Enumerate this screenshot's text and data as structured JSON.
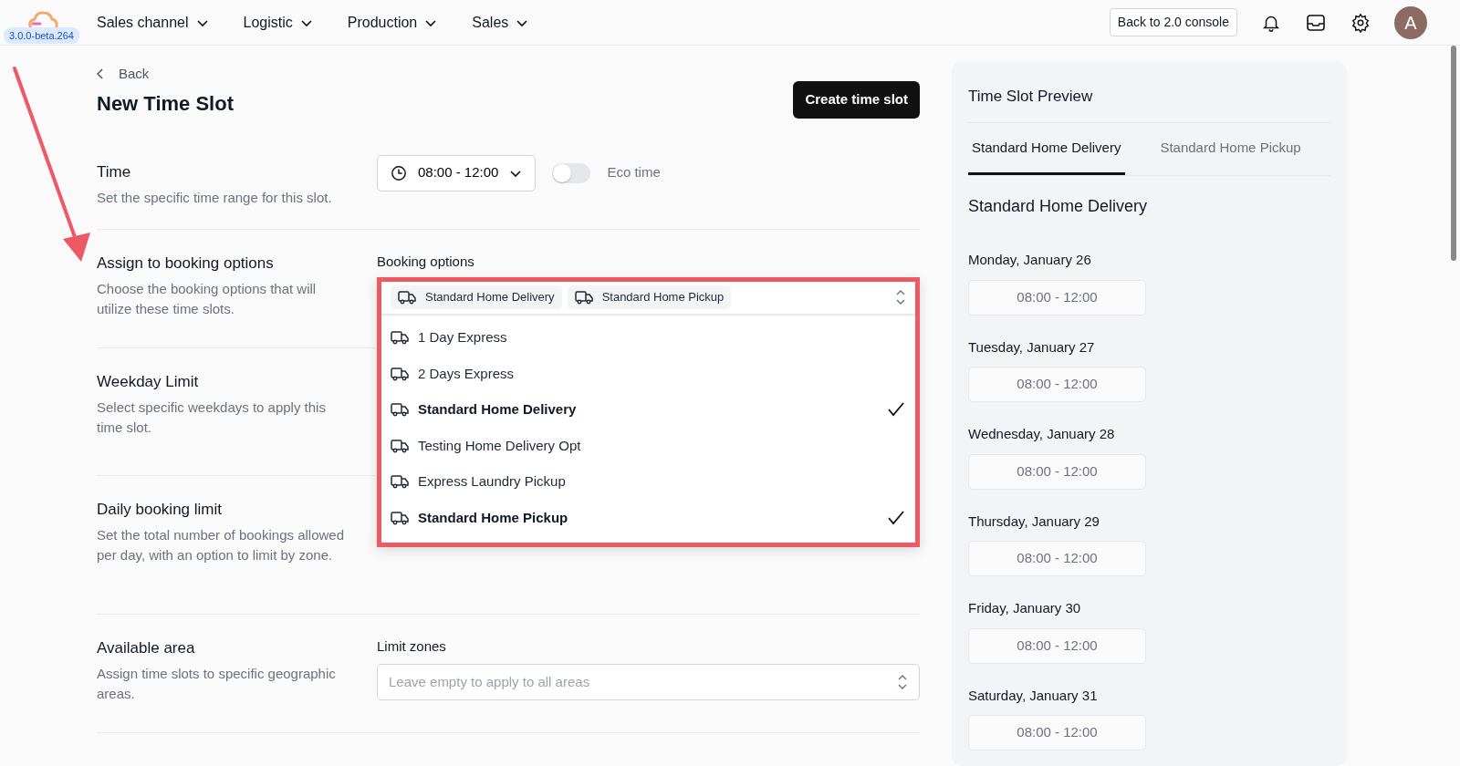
{
  "nav": {
    "version": "3.0.0-beta.264",
    "menus": [
      "Sales channel",
      "Logistic",
      "Production",
      "Sales"
    ],
    "console_button": "Back to 2.0 console",
    "avatar": "A"
  },
  "page": {
    "back": "Back",
    "title": "New Time Slot",
    "create_button": "Create time slot"
  },
  "sections": [
    {
      "kind": "time",
      "title": "Time",
      "description": "Set the specific time range for this slot.",
      "time_value": "08:00 - 12:00",
      "toggle_label": "Eco time",
      "toggle_on": false
    },
    {
      "kind": "booking",
      "title": "Assign to booking options",
      "description": "Choose the booking options that will utilize these time slots.",
      "field_label": "Booking options",
      "chips": [
        "Standard Home Delivery",
        "Standard Home Pickup"
      ],
      "expanded": true,
      "options": [
        {
          "label": "1 Day Express",
          "selected": false
        },
        {
          "label": "2 Days Express",
          "selected": false
        },
        {
          "label": "Standard Home Delivery",
          "selected": true
        },
        {
          "label": "Testing Home Delivery Opt",
          "selected": false
        },
        {
          "label": "Express Laundry Pickup",
          "selected": false
        },
        {
          "label": "Standard Home Pickup",
          "selected": true
        }
      ]
    },
    {
      "kind": "plain",
      "title": "Weekday Limit",
      "description": "Select specific weekdays to apply this time slot."
    },
    {
      "kind": "plain",
      "title": "Daily booking limit",
      "description": "Set the total number of bookings allowed per day, with an option to limit by zone."
    },
    {
      "kind": "select",
      "title": "Available area",
      "description": "Assign time slots to specific geographic areas.",
      "field_label": "Limit zones",
      "placeholder": "Leave empty to apply to all areas"
    }
  ],
  "preview": {
    "title": "Time Slot Preview",
    "tabs": [
      {
        "label": "Standard Home Delivery",
        "selected": true
      },
      {
        "label": "Standard Home Pickup",
        "selected": false
      }
    ],
    "heading": "Standard Home Delivery",
    "days": [
      {
        "date": "Monday, January 26",
        "slot": "08:00 - 12:00"
      },
      {
        "date": "Tuesday, January 27",
        "slot": "08:00 - 12:00"
      },
      {
        "date": "Wednesday, January 28",
        "slot": "08:00 - 12:00"
      },
      {
        "date": "Thursday, January 29",
        "slot": "08:00 - 12:00"
      },
      {
        "date": "Friday, January 30",
        "slot": "08:00 - 12:00"
      },
      {
        "date": "Saturday, January 31",
        "slot": "08:00 - 12:00"
      }
    ]
  }
}
